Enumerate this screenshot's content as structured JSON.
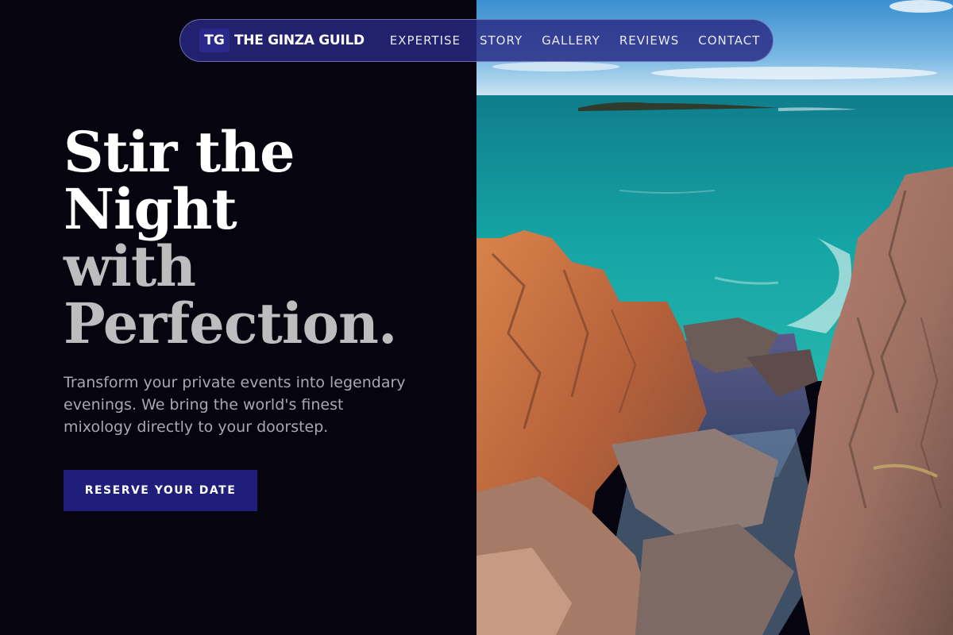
{
  "brand": {
    "badge": "TG",
    "name": "THE GINZA GUILD"
  },
  "nav": {
    "links": [
      "EXPERTISE",
      "STORY",
      "GALLERY",
      "REVIEWS",
      "CONTACT"
    ]
  },
  "hero": {
    "title_lines": [
      "Stir the",
      "Night",
      "with",
      "Perfection."
    ],
    "description": "Transform your private events into legendary evenings. We bring the world's finest mixology directly to your doorstep.",
    "cta_label": "RESERVE YOUR DATE"
  },
  "colors": {
    "background": "#05040f",
    "accent": "#1f1e7a",
    "nav_background": "#28288a"
  }
}
